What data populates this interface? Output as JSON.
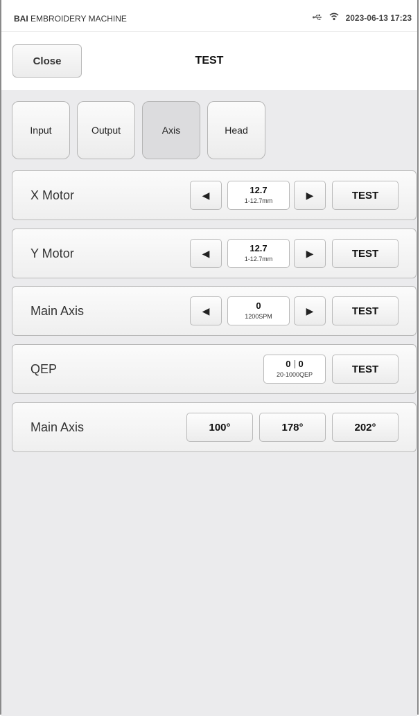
{
  "status_bar": {
    "app_prefix": "BAI",
    "app_suffix": " EMBROIDERY MACHINE",
    "datetime": "2023-06-13 17:23",
    "icons": [
      "usb-icon",
      "wifi-icon"
    ]
  },
  "header": {
    "close_label": "Close",
    "title": "TEST"
  },
  "tabs": [
    {
      "label": "Input",
      "active": false
    },
    {
      "label": "Output",
      "active": false
    },
    {
      "label": "Axis",
      "active": true
    },
    {
      "label": "Head",
      "active": false
    }
  ],
  "rows": {
    "x_motor": {
      "label": "X Motor",
      "value": "12.7",
      "range": "1-12.7mm",
      "test_label": "TEST"
    },
    "y_motor": {
      "label": "Y Motor",
      "value": "12.7",
      "range": "1-12.7mm",
      "test_label": "TEST"
    },
    "main_axis": {
      "label": "Main Axis",
      "value": "0",
      "range": "1200SPM",
      "test_label": "TEST"
    },
    "qep": {
      "label": "QEP",
      "value_a": "0",
      "value_b": "0",
      "range": "20-1000QEP",
      "test_label": "TEST"
    },
    "main_axis_angles": {
      "label": "Main Axis",
      "angles": [
        "100°",
        "178°",
        "202°"
      ]
    }
  },
  "glyphs": {
    "left_arrow": "◀",
    "right_arrow": "▶",
    "usb": "⭠",
    "wifi": "ᯤ"
  }
}
